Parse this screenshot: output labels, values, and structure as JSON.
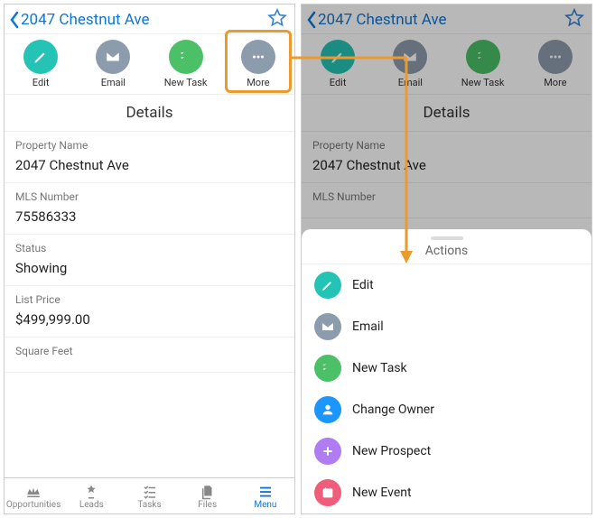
{
  "header": {
    "title": "2047 Chestnut Ave"
  },
  "quickActions": [
    {
      "label": "Edit",
      "icon": "pencil",
      "color": "c-teal"
    },
    {
      "label": "Email",
      "icon": "envelope",
      "color": "c-grey"
    },
    {
      "label": "New Task",
      "icon": "checklist",
      "color": "c-green"
    },
    {
      "label": "More",
      "icon": "dots",
      "color": "c-grey"
    }
  ],
  "detailsTitle": "Details",
  "fields": [
    {
      "label": "Property Name",
      "value": "2047 Chestnut Ave"
    },
    {
      "label": "MLS Number",
      "value": "75586333"
    },
    {
      "label": "Status",
      "value": "Showing"
    },
    {
      "label": "List Price",
      "value": "$499,999.00"
    },
    {
      "label": "Square Feet",
      "value": ""
    }
  ],
  "rightFields": [
    {
      "label": "Property Name",
      "value": "2047 Chestnut Ave"
    },
    {
      "label": "MLS Number",
      "value": ""
    }
  ],
  "tabs": [
    {
      "label": "Opportunities",
      "icon": "crown"
    },
    {
      "label": "Leads",
      "icon": "star"
    },
    {
      "label": "Tasks",
      "icon": "checklist"
    },
    {
      "label": "Files",
      "icon": "files"
    },
    {
      "label": "Menu",
      "icon": "menu",
      "active": true
    }
  ],
  "sheet": {
    "title": "Actions",
    "items": [
      {
        "label": "Edit",
        "icon": "pencil",
        "color": "c-teal"
      },
      {
        "label": "Email",
        "icon": "envelope",
        "color": "c-grey"
      },
      {
        "label": "New Task",
        "icon": "checklist",
        "color": "c-green"
      },
      {
        "label": "Change Owner",
        "icon": "user",
        "color": "c-blue"
      },
      {
        "label": "New Prospect",
        "icon": "plus",
        "color": "c-purple"
      },
      {
        "label": "New Event",
        "icon": "calendar",
        "color": "c-pink"
      }
    ]
  }
}
